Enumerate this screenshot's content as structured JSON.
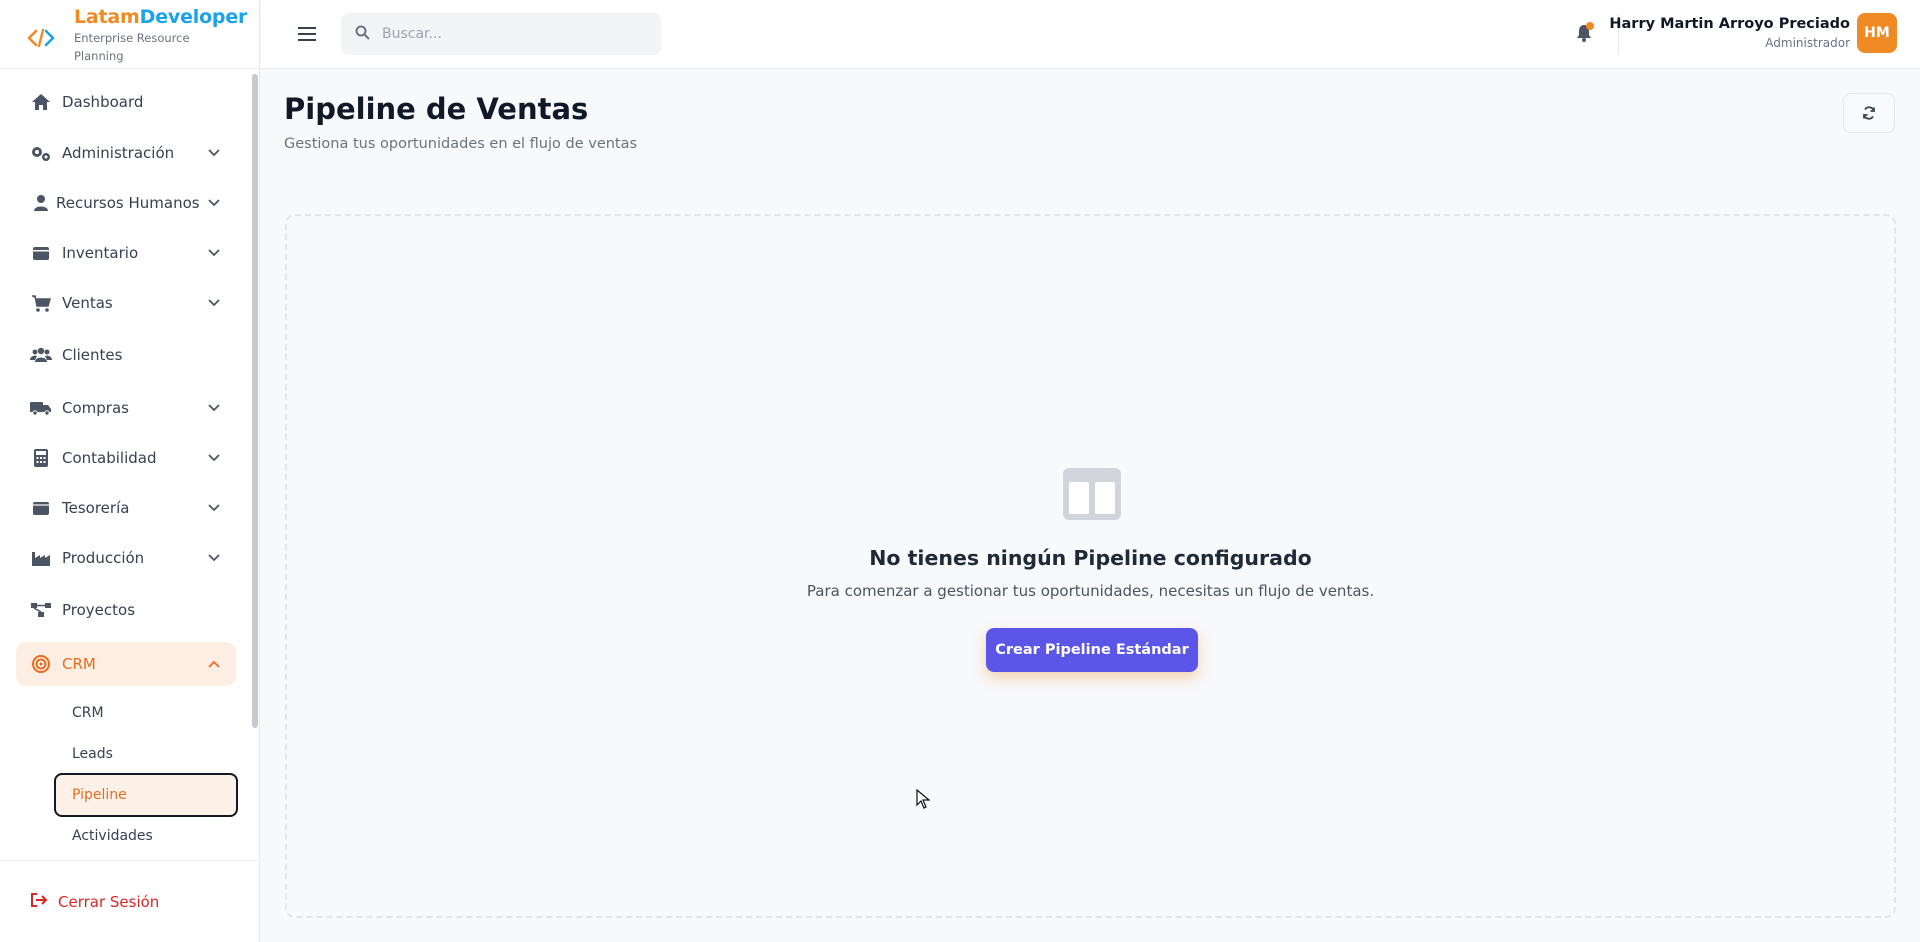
{
  "brand": {
    "name_part1": "Latam",
    "name_part2": "Developer",
    "subtitle": "Enterprise Resource Planning"
  },
  "sidebar": {
    "items": [
      {
        "label": "Dashboard",
        "icon": "home-icon"
      },
      {
        "label": "Administración",
        "icon": "gears-icon"
      },
      {
        "label": "Recursos Humanos",
        "icon": "user-icon"
      },
      {
        "label": "Inventario",
        "icon": "box-icon"
      },
      {
        "label": "Ventas",
        "icon": "cart-icon"
      },
      {
        "label": "Clientes",
        "icon": "users-icon"
      },
      {
        "label": "Compras",
        "icon": "truck-icon"
      },
      {
        "label": "Contabilidad",
        "icon": "calculator-icon"
      },
      {
        "label": "Tesorería",
        "icon": "wallet-icon"
      },
      {
        "label": "Producción",
        "icon": "industry-icon"
      },
      {
        "label": "Proyectos",
        "icon": "diagram-icon"
      },
      {
        "label": "CRM",
        "icon": "target-icon",
        "active": true
      }
    ],
    "crm_subitems": [
      {
        "label": "CRM"
      },
      {
        "label": "Leads"
      },
      {
        "label": "Pipeline",
        "active": true
      },
      {
        "label": "Actividades"
      }
    ],
    "logout_label": "Cerrar Sesión"
  },
  "header": {
    "search_placeholder": "Buscar...",
    "user_name": "Harry Martin Arroyo Preciado",
    "user_role": "Administrador",
    "avatar_initials": "HM"
  },
  "main": {
    "title": "Pipeline de Ventas",
    "subtitle": "Gestiona tus oportunidades en el flujo de ventas",
    "empty_title": "No tienes ningún Pipeline configurado",
    "empty_description": "Para comenzar a gestionar tus oportunidades, necesitas un flujo de ventas.",
    "create_button": "Crear Pipeline Estándar"
  },
  "colors": {
    "accent": "#f08a24",
    "brand_blue": "#1aa3e8",
    "primary_button": "#5b55e8",
    "danger": "#dc2626"
  }
}
